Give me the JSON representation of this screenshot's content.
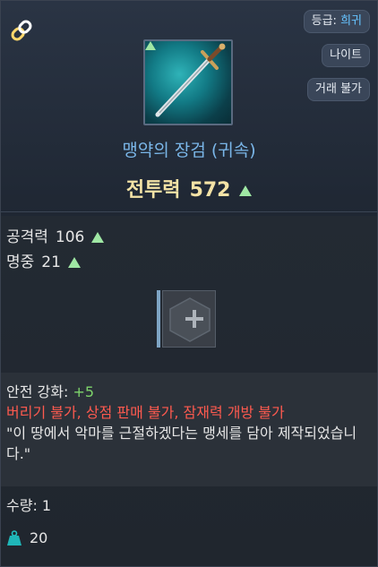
{
  "header": {
    "grade_label": "등급: ",
    "grade_value": "희귀",
    "class_label": "나이트",
    "trade_label": "거래 불가"
  },
  "item": {
    "name": "맹약의 장검 (귀속)",
    "power_label": "전투력",
    "power_value": "572"
  },
  "stats": [
    {
      "label": "공격력",
      "value": "106"
    },
    {
      "label": "명중",
      "value": "21"
    }
  ],
  "description": {
    "safe_label": "안전 강화: ",
    "safe_value": "+5",
    "restriction": "버리기 불가, 상점 판매 불가, 잠재력 개방 불가",
    "flavor": "\"이 땅에서 악마를 근절하겠다는 맹세를 담아 제작되었습니다.\""
  },
  "quantity": {
    "label": "수량: ",
    "value": "1"
  },
  "weight": {
    "value": "20"
  },
  "colors": {
    "grade": "#66c3ff",
    "name": "#7ab6e8",
    "power": "#f4e3a6",
    "up_arrow": "#9fe7a4",
    "safe_enhance": "#7ed46b",
    "restriction": "#ff5a4f"
  },
  "icons": [
    "link-icon",
    "sword-icon",
    "up-arrow-icon",
    "plus-icon",
    "weight-icon"
  ]
}
